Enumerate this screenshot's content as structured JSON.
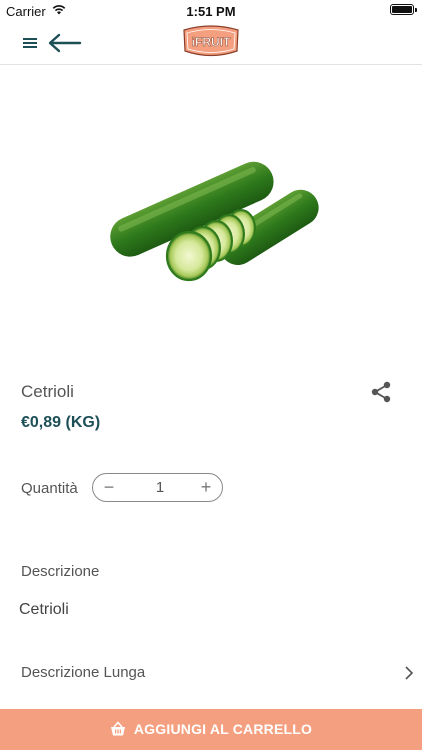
{
  "status_bar": {
    "carrier": "Carrier",
    "time": "1:51 PM"
  },
  "header": {
    "logo_text": "iFRUIT"
  },
  "product": {
    "name": "Cetrioli",
    "price": "€0,89 (KG)"
  },
  "quantity": {
    "label": "Quantità",
    "value": "1",
    "minus": "−",
    "plus": "+"
  },
  "description": {
    "title": "Descrizione",
    "text": "Cetrioli"
  },
  "long_description": {
    "label": "Descrizione Lunga"
  },
  "cta": {
    "label": "AGGIUNGI AL CARRELLO"
  },
  "colors": {
    "brand": "#f4a080",
    "price": "#1d4f57",
    "header_icons": "#1d4f57"
  }
}
